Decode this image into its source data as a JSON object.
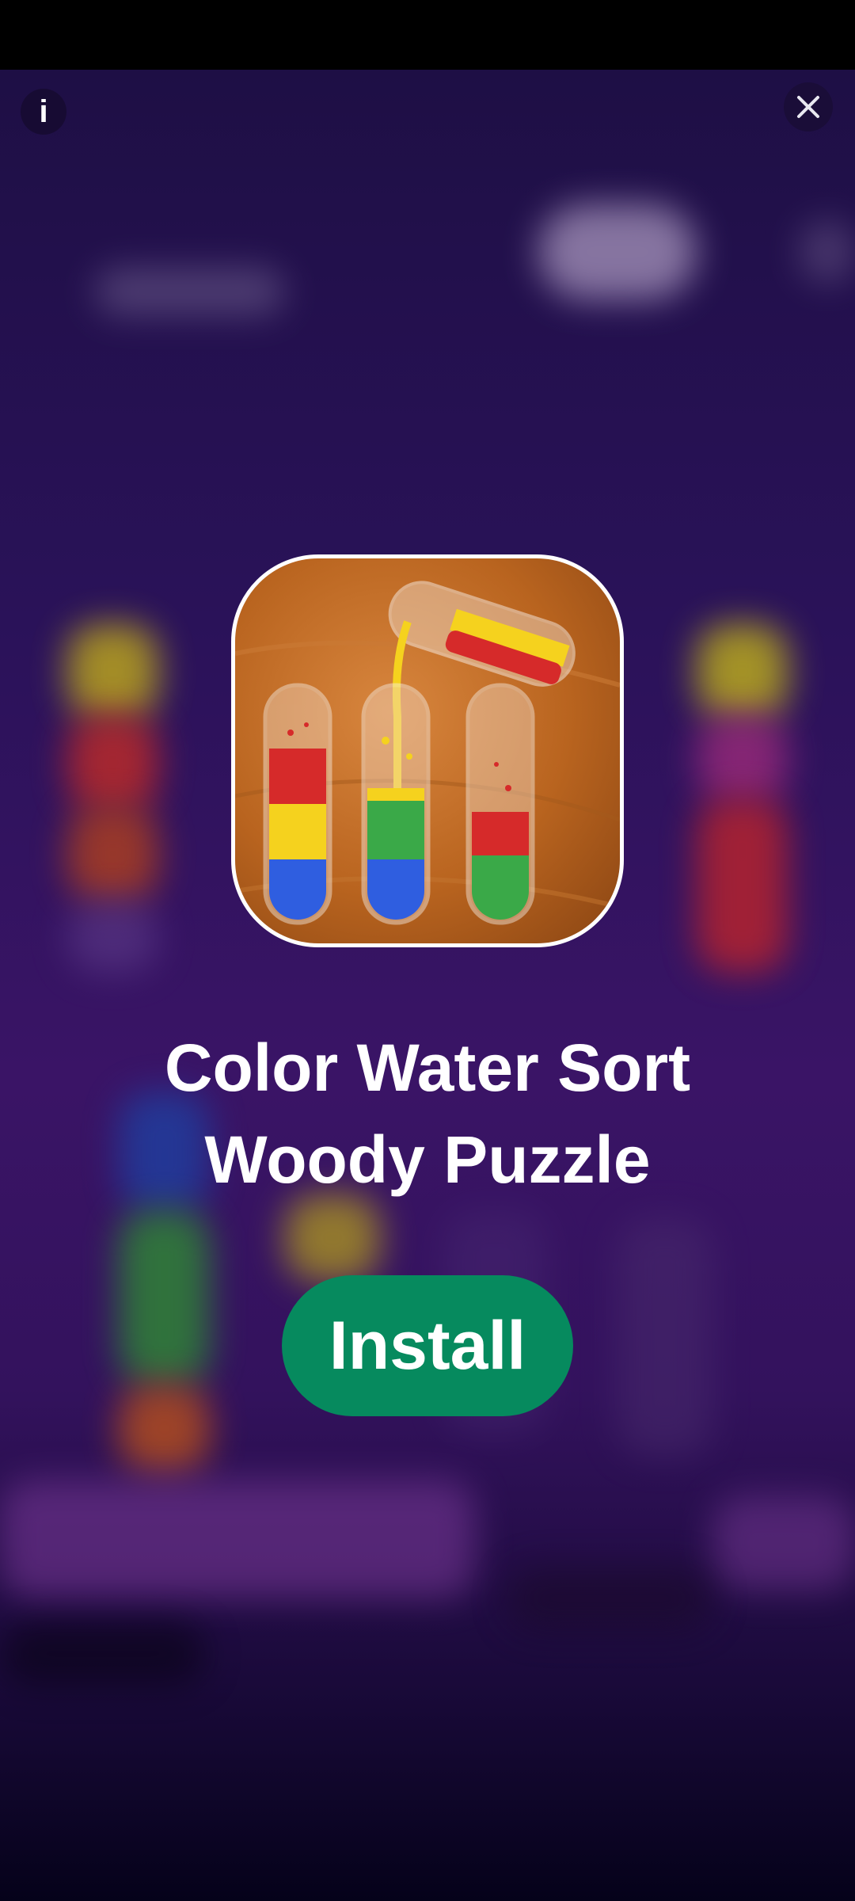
{
  "ad": {
    "info_label": "i",
    "close_icon": "close-icon",
    "app_icon": "color-water-sort-app-icon",
    "title_line1": "Color Water Sort",
    "title_line2": "Woody Puzzle",
    "install_label": "Install"
  },
  "colors": {
    "background_top": "#1e0f45",
    "background_mid": "#3a1466",
    "install_button": "#068a5e",
    "icon_wood": "#b9641f",
    "liquid_red": "#d62a2a",
    "liquid_yellow": "#f5d21e",
    "liquid_blue": "#2f5ee0",
    "liquid_green": "#3aa948"
  }
}
